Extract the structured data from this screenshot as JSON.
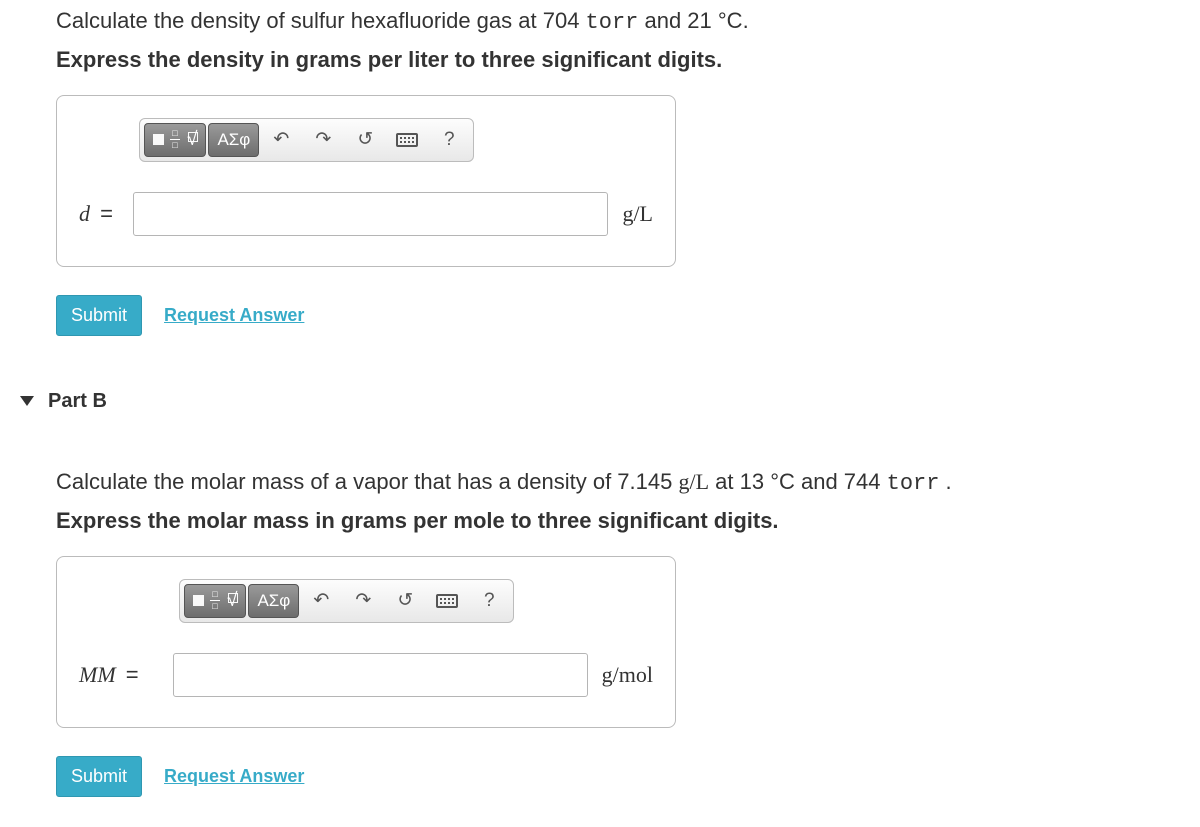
{
  "partA": {
    "question_prefix": "Calculate the density of sulfur hexafluoride gas at 704 ",
    "torr_text": "torr",
    "question_mid": " and 21 ",
    "degree_unit": "°C",
    "question_suffix": ".",
    "instruction": "Express the density in grams per liter to three significant digits.",
    "lhs_symbol": "d",
    "lhs_eq": " =",
    "unit": "g/L",
    "answer_value": "",
    "answer_placeholder": ""
  },
  "toolbar": {
    "greek_label": "ΑΣφ",
    "undo": "↶",
    "redo": "↷",
    "reset": "↺",
    "help": "?"
  },
  "buttons": {
    "submit": "Submit",
    "request": "Request Answer"
  },
  "partB": {
    "header": "Part B",
    "question_p1": "Calculate the molar mass of a vapor that has a density of 7.145 ",
    "gL": "g/L",
    "question_p2": " at 13 ",
    "degree_unit": "°C",
    "question_p3": " and 744 ",
    "torr_text": "torr",
    "question_p4": " .",
    "instruction": "Express the molar mass in grams per mole to three significant digits.",
    "lhs_symbol": "MM",
    "lhs_eq": " =",
    "unit": "g/mol",
    "answer_value": "",
    "answer_placeholder": ""
  }
}
